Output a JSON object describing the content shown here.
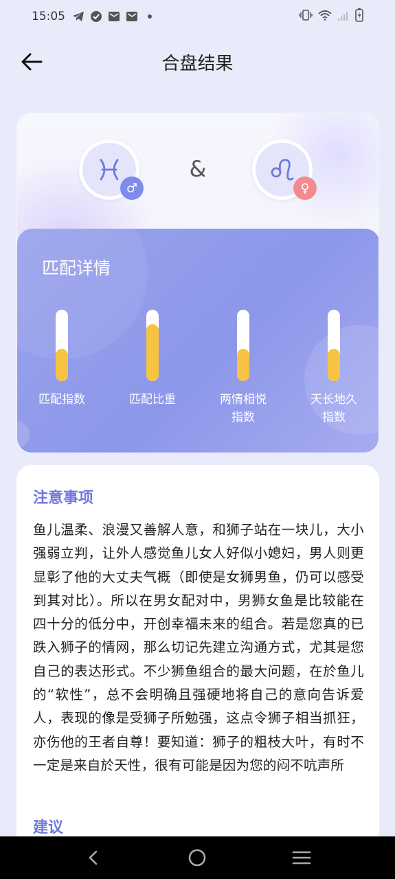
{
  "status_bar": {
    "time": "15:05",
    "icons": [
      "telegram-icon",
      "check-icon",
      "mail-icon",
      "mail-icon",
      "dot-icon",
      "vibrate-icon",
      "wifi-icon",
      "signal-icon",
      "battery-charging-icon"
    ]
  },
  "header": {
    "title": "合盘结果",
    "back_icon": "arrow-left-icon"
  },
  "match": {
    "male_sign": "pisces-icon",
    "female_sign": "leo-icon",
    "separator": "&",
    "male_symbol": "♂",
    "female_symbol": "♀"
  },
  "details": {
    "title": "匹配详情",
    "meters": [
      {
        "label": "匹配指数",
        "value": 0.45
      },
      {
        "label": "匹配比重",
        "value": 0.8
      },
      {
        "label": "两情相悦\n指数",
        "value": 0.45
      },
      {
        "label": "天长地久\n指数",
        "value": 0.45
      }
    ]
  },
  "notice": {
    "title": "注意事项",
    "body": "鱼儿温柔、浪漫又善解人意，和狮子站在一块儿，大小强弱立判，让外人感觉鱼儿女人好似小媳妇，男人则更显彰了他的大丈夫气概（即使是女狮男鱼，仍可以感受到其对比）。所以在男女配对中，男狮女鱼是比较能在四十分的低分中，开创幸福未来的组合。若是您真的已跌入狮子的情网，那么切记先建立沟通方式，尤其是您自己的表达形式。不少狮鱼组合的最大问题，在於鱼儿的“软性”，总不会明确且强硬地将自己的意向告诉爱人，表现的像是受狮子所勉强，这点令狮子相当抓狂，亦伤他的王者自尊！要知道：狮子的粗枝大叶，有时不一定是来自於天性，很有可能是因为您的闷不吭声所",
    "next_title": "建议"
  },
  "colors": {
    "accent": "#6d78e0",
    "panel": "#8d97ea",
    "meter_fill": "#f6c343",
    "male": "#7f8bea",
    "female": "#f28b8f"
  }
}
